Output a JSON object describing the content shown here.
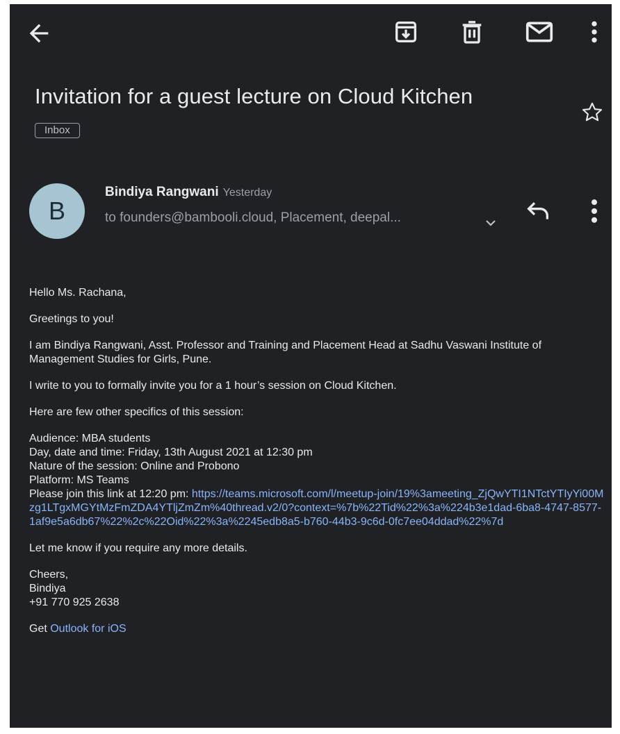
{
  "subject": "Invitation for a guest lecture on Cloud Kitchen",
  "label": "Inbox",
  "sender": {
    "avatar_letter": "B",
    "name": "Bindiya Rangwani",
    "time": "Yesterday",
    "recipients": "to founders@bambooli.cloud, Placement, deepal..."
  },
  "body": {
    "salutation": "Hello Ms. Rachana,",
    "greeting": "Greetings to you!",
    "intro": "I am Bindiya Rangwani, Asst. Professor and Training and Placement Head at Sadhu Vaswani Institute of Management Studies for Girls, Pune.",
    "invite": "I write to you to formally invite you for a 1 hour’s session on Cloud Kitchen.",
    "specifics_heading": "Here are few other specifics of this session:",
    "audience": "Audience: MBA students",
    "datetime": "Day, date and time: Friday, 13th August 2021 at 12:30 pm",
    "nature": "Nature of the session: Online and Probono",
    "platform": "Platform: MS Teams",
    "join_prefix": "Please join this link at 12:20 pm: ",
    "join_link": "https://teams.microsoft.com/l/meetup-join/19%3ameeting_ZjQwYTI1NTctYTIyYi00Mzg1LTgxMGYtMzFmZDA4YTljZmZm%40thread.v2/0?context=%7b%22Tid%22%3a%224b3e1dad-6ba8-4747-8577-1af9e5a6db67%22%2c%22Oid%22%3a%2245edb8a5-b760-44b3-9c6d-0fc7ee04ddad%22%7d",
    "more_details": "Let me know if you require any more details.",
    "signoff": "Cheers,",
    "sig_name": "Bindiya",
    "phone": "+91 770 925 2638",
    "get_prefix": "Get ",
    "get_link": "Outlook for iOS"
  },
  "icons": {
    "back": "arrow-back-icon",
    "archive": "archive-icon",
    "delete": "trash-icon",
    "mark_unread": "mail-icon",
    "more": "more-vert-icon",
    "star": "star-outline-icon",
    "expand": "chevron-down-icon",
    "reply": "reply-icon"
  },
  "colors": {
    "background": "#202124",
    "text": "#e8eaed",
    "secondary_text": "#9aa0a6",
    "link": "#8ab4f8",
    "avatar": "#a7c4d3"
  }
}
